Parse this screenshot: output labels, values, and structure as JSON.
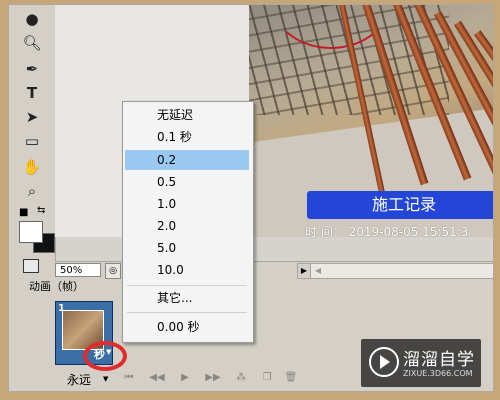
{
  "canvas": {
    "banner_title": "施工记录",
    "timestamp": "时   间： 2019-08-05 15:51:3"
  },
  "status": {
    "zoom": "50%"
  },
  "animation_panel": {
    "title": "动画（帧）",
    "frame_number": "1",
    "frame_delay": "秒",
    "loop": "永远"
  },
  "delay_menu": {
    "items": [
      "无延迟",
      "0.1 秒",
      "0.2",
      "0.5",
      "1.0",
      "2.0",
      "5.0",
      "10.0"
    ],
    "other": "其它...",
    "current": "0.00 秒",
    "selected_index": 2
  },
  "watermark": {
    "brand": "溜溜自学",
    "url": "ZIXUE.3D66.COM"
  },
  "colors": {
    "menu_highlight": "#99c9f1",
    "banner": "#2446d6",
    "frame_selected": "#3a6ea5",
    "annotation_circle": "#e22b2b"
  }
}
